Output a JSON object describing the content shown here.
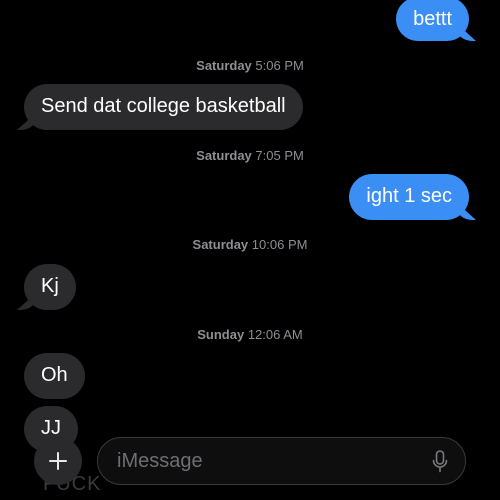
{
  "messages": [
    {
      "kind": "sent",
      "text": "bettt"
    },
    {
      "kind": "timestamp",
      "day": "Saturday",
      "time": "5:06 PM"
    },
    {
      "kind": "received",
      "text": "Send dat college basketball"
    },
    {
      "kind": "timestamp",
      "day": "Saturday",
      "time": "7:05 PM"
    },
    {
      "kind": "sent",
      "text": "ight 1 sec"
    },
    {
      "kind": "timestamp",
      "day": "Saturday",
      "time": "10:06 PM"
    },
    {
      "kind": "received",
      "text": "Kj"
    },
    {
      "kind": "timestamp",
      "day": "Sunday",
      "time": "12:06 AM"
    },
    {
      "kind": "received",
      "text": "Oh"
    },
    {
      "kind": "received",
      "text": "JJ"
    },
    {
      "kind": "received",
      "text": "FUCK"
    }
  ],
  "composer": {
    "placeholder": "iMessage",
    "add_icon": "plus-icon",
    "mic_icon": "microphone-icon"
  },
  "colors": {
    "background": "#000000",
    "sent_bubble": "#3b8ef3",
    "received_bubble": "#2b2b2d",
    "timestamp": "#8e8e93"
  }
}
